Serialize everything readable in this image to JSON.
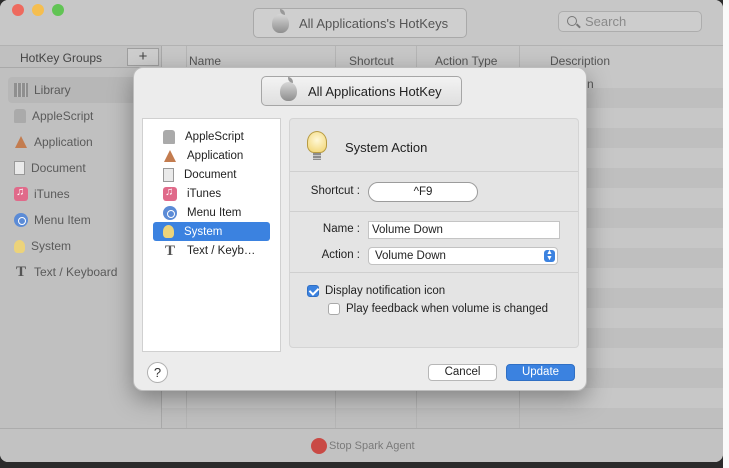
{
  "background_window": {
    "title": "All Applications's HotKeys",
    "search_placeholder": "Search",
    "sidebar": {
      "header": "HotKey Groups",
      "add_label": "+",
      "items": [
        {
          "label": "Library",
          "icon": "library-icon"
        },
        {
          "label": "AppleScript",
          "icon": "applescript-icon"
        },
        {
          "label": "Application",
          "icon": "application-icon"
        },
        {
          "label": "Document",
          "icon": "document-icon"
        },
        {
          "label": "iTunes",
          "icon": "itunes-icon"
        },
        {
          "label": "Menu Item",
          "icon": "menu-item-icon"
        },
        {
          "label": "System",
          "icon": "system-icon"
        },
        {
          "label": "Text / Keyboard",
          "icon": "text-icon"
        }
      ]
    },
    "table": {
      "columns": [
        "Name",
        "Shortcut",
        "Action Type",
        "Description"
      ],
      "partial_cell": "n"
    },
    "stop_button": "Stop Spark Agent"
  },
  "dialog": {
    "title": "All Applications HotKey",
    "types": [
      {
        "label": "AppleScript"
      },
      {
        "label": "Application"
      },
      {
        "label": "Document"
      },
      {
        "label": "iTunes"
      },
      {
        "label": "Menu Item"
      },
      {
        "label": "System"
      },
      {
        "label": "Text / Keyb…"
      }
    ],
    "panel": {
      "title": "System Action",
      "shortcut_label": "Shortcut :",
      "shortcut_value": "^F9",
      "name_label": "Name :",
      "name_value": "Volume Down",
      "action_label": "Action :",
      "action_value": "Volume Down",
      "display_notification_label": "Display notification icon",
      "display_notification_checked": true,
      "play_feedback_label": "Play feedback when volume is changed",
      "play_feedback_checked": false
    },
    "help_label": "?",
    "cancel_label": "Cancel",
    "update_label": "Update"
  },
  "colors": {
    "accent": "#3b82e0",
    "close": "#ee6a5e",
    "minimize": "#f5be4f",
    "zoom": "#61c454"
  }
}
